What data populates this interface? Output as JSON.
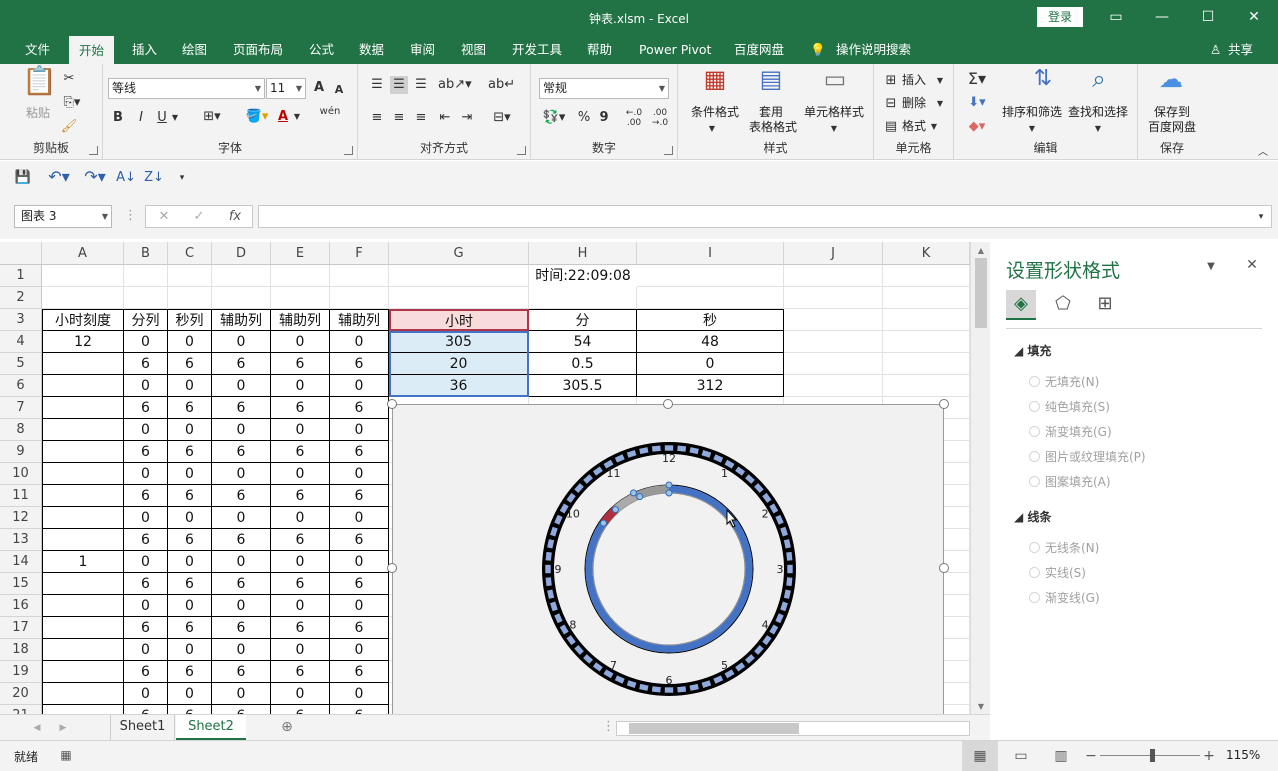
{
  "window": {
    "title": "钟表.xlsm  -  Excel",
    "login": "登录"
  },
  "tabs": [
    "文件",
    "开始",
    "插入",
    "绘图",
    "页面布局",
    "公式",
    "数据",
    "审阅",
    "视图",
    "开发工具",
    "帮助",
    "Power Pivot",
    "百度网盘",
    "操作说明搜索"
  ],
  "share": "共享",
  "ribbon": {
    "clipboard": {
      "label": "剪贴板",
      "paste": "粘贴"
    },
    "font": {
      "label": "字体",
      "name": "等线",
      "size": "11",
      "bold": "B",
      "italic": "I",
      "underline": "U",
      "grow": "A",
      "shrink": "A",
      "wen": "wén",
      "fontcolor": "A"
    },
    "align": {
      "label": "对齐方式"
    },
    "number": {
      "label": "数字",
      "format": "常规",
      "percent": "%",
      "comma": "9",
      "incdec": "←.0 .00",
      "decdec": ".00 →.0"
    },
    "styles": {
      "label": "样式",
      "cond": "条件格式",
      "table_a": "套用",
      "table_b": "表格格式",
      "cell": "单元格样式"
    },
    "cells": {
      "label": "单元格",
      "insert": "插入",
      "delete": "删除",
      "format": "格式"
    },
    "editing": {
      "label": "编辑",
      "sort": "排序和筛选",
      "find": "查找和选择"
    },
    "save": {
      "label": "保存",
      "save_a": "保存到",
      "save_b": "百度网盘"
    }
  },
  "namebox": "图表 3",
  "fx": "fx",
  "columns": [
    "A",
    "B",
    "C",
    "D",
    "E",
    "F",
    "G",
    "H",
    "I",
    "J",
    "K"
  ],
  "rows": [
    "1",
    "2",
    "3",
    "4",
    "5",
    "6",
    "7",
    "8",
    "9",
    "10",
    "11",
    "12",
    "13",
    "14",
    "15",
    "16",
    "17",
    "18",
    "19",
    "20",
    "21"
  ],
  "time_label": "时间:22:09:08",
  "header_row": [
    "小时刻度",
    "分列",
    "秒列",
    "辅助列",
    "辅助列",
    "辅助列"
  ],
  "table_left": [
    [
      "12",
      "0",
      "0",
      "0",
      "0",
      "0"
    ],
    [
      "",
      "6",
      "6",
      "6",
      "6",
      "6"
    ],
    [
      "",
      "0",
      "0",
      "0",
      "0",
      "0"
    ],
    [
      "",
      "6",
      "6",
      "6",
      "6",
      "6"
    ],
    [
      "",
      "0",
      "0",
      "0",
      "0",
      "0"
    ],
    [
      "",
      "6",
      "6",
      "6",
      "6",
      "6"
    ],
    [
      "",
      "0",
      "0",
      "0",
      "0",
      "0"
    ],
    [
      "",
      "6",
      "6",
      "6",
      "6",
      "6"
    ],
    [
      "",
      "0",
      "0",
      "0",
      "0",
      "0"
    ],
    [
      "",
      "6",
      "6",
      "6",
      "6",
      "6"
    ],
    [
      "1",
      "0",
      "0",
      "0",
      "0",
      "0"
    ],
    [
      "",
      "6",
      "6",
      "6",
      "6",
      "6"
    ],
    [
      "",
      "0",
      "0",
      "0",
      "0",
      "0"
    ],
    [
      "",
      "6",
      "6",
      "6",
      "6",
      "6"
    ],
    [
      "",
      "0",
      "0",
      "0",
      "0",
      "0"
    ],
    [
      "",
      "6",
      "6",
      "6",
      "6",
      "6"
    ],
    [
      "",
      "0",
      "0",
      "0",
      "0",
      "0"
    ],
    [
      "",
      "6",
      "6",
      "6",
      "6",
      "6"
    ]
  ],
  "right_table": {
    "headers": [
      "小时",
      "分",
      "秒"
    ],
    "rows": [
      [
        "305",
        "54",
        "48"
      ],
      [
        "20",
        "0.5",
        "0"
      ],
      [
        "36",
        "305.5",
        "312"
      ]
    ]
  },
  "clock": {
    "numbers": [
      "12",
      "1",
      "2",
      "3",
      "4",
      "5",
      "6",
      "7",
      "8",
      "9",
      "10",
      "11"
    ]
  },
  "sheets": [
    "Sheet1",
    "Sheet2"
  ],
  "status": {
    "ready": "就绪",
    "zoom": "115%"
  },
  "pane": {
    "title": "设置形状格式",
    "fill_section": "填充",
    "fill_options": [
      "无填充(N)",
      "纯色填充(S)",
      "渐变填充(G)",
      "图片或纹理填充(P)",
      "图案填充(A)"
    ],
    "line_section": "线条",
    "line_options": [
      "无线条(N)",
      "实线(S)",
      "渐变线(G)"
    ]
  },
  "colors": {
    "excel_green": "#217346",
    "ring_blue": "#4472c4",
    "tick_blue": "#8fa9dc"
  }
}
